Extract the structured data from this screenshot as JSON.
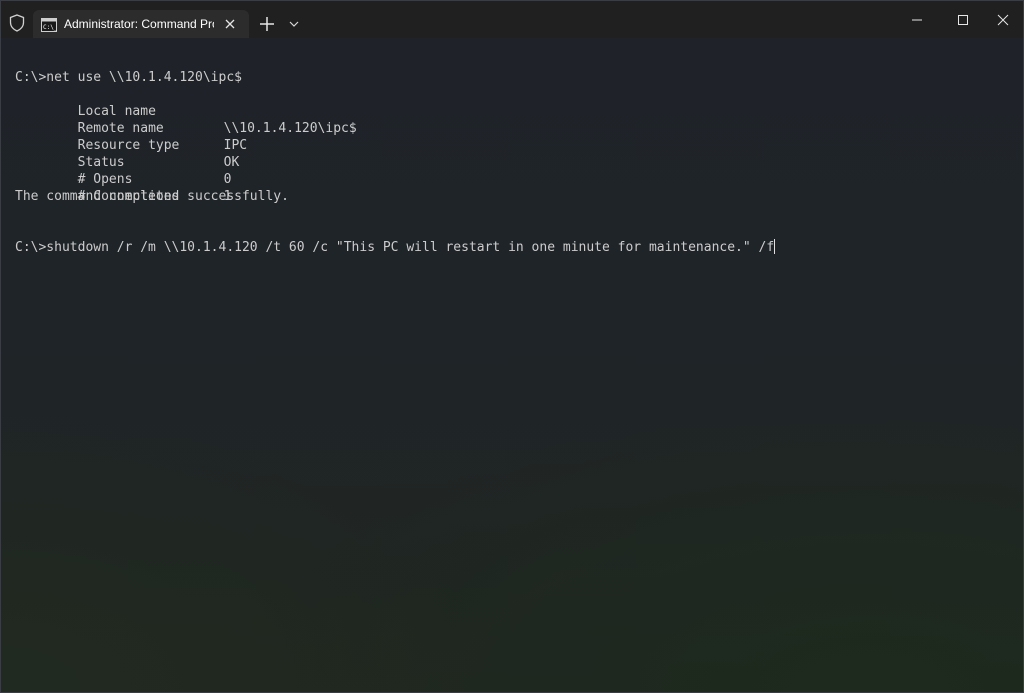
{
  "window": {
    "tab_title": "Administrator: Command Prompt",
    "icons": {
      "shield": "shield-icon",
      "tab": "command-prompt-icon",
      "close_tab": "close-icon",
      "new_tab": "plus-icon",
      "dropdown": "chevron-down-icon",
      "minimize": "minimize-icon",
      "maximize": "maximize-icon",
      "close_window": "close-icon"
    }
  },
  "terminal": {
    "cmd1": "C:\\>net use \\\\10.1.4.120\\ipc$",
    "rows": [
      {
        "label": "Local name",
        "value": ""
      },
      {
        "label": "Remote name",
        "value": "\\\\10.1.4.120\\ipc$"
      },
      {
        "label": "Resource type",
        "value": "IPC"
      },
      {
        "label": "Status",
        "value": "OK"
      },
      {
        "label": "# Opens",
        "value": "0"
      },
      {
        "label": "# Connections",
        "value": "1"
      }
    ],
    "result": "The command completed successfully.",
    "cmd2": "C:\\>shutdown /r /m \\\\10.1.4.120 /t 60 /c \"This PC will restart in one minute for maintenance.\" /f"
  },
  "colors": {
    "titlebar": "#202020",
    "tab": "#2c2c2c",
    "terminal_bg": "#1f2329",
    "text": "#cccccc"
  }
}
